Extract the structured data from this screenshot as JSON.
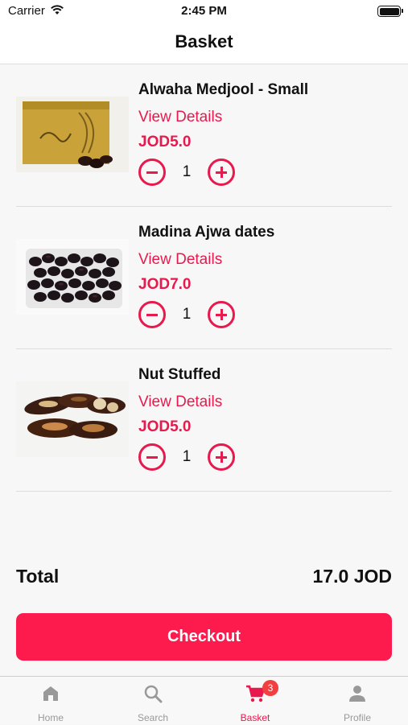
{
  "status_bar": {
    "carrier": "Carrier",
    "time": "2:45 PM"
  },
  "header": {
    "title": "Basket"
  },
  "items": [
    {
      "name": "Alwaha Medjool - Small",
      "details_label": "View Details",
      "price": "JOD5.0",
      "quantity": "1",
      "image": "gold-box-dates"
    },
    {
      "name": "Madina Ajwa dates",
      "details_label": "View Details",
      "price": "JOD7.0",
      "quantity": "1",
      "image": "ajwa-dates-tray"
    },
    {
      "name": "Nut Stuffed",
      "details_label": "View Details",
      "price": "JOD5.0",
      "quantity": "1",
      "image": "nut-stuffed-dates"
    }
  ],
  "summary": {
    "total_label": "Total",
    "total_value": "17.0 JOD"
  },
  "checkout": {
    "label": "Checkout"
  },
  "tabbar": {
    "tabs": [
      {
        "label": "Home",
        "icon": "home-icon"
      },
      {
        "label": "Search",
        "icon": "search-icon"
      },
      {
        "label": "Basket",
        "icon": "cart-icon",
        "badge": "3",
        "active": true
      },
      {
        "label": "Profile",
        "icon": "person-icon"
      }
    ]
  },
  "colors": {
    "accent": "#e8194d",
    "checkout_bg": "#fd1a4d",
    "badge": "#f33f3f",
    "inactive_tab": "#999999"
  }
}
